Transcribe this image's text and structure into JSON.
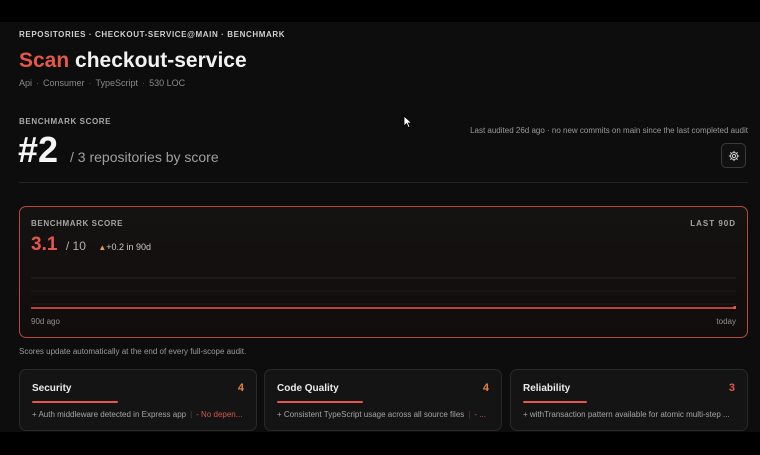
{
  "breadcrumb": "REPOSITORIES · CHECKOUT-SERVICE@MAIN · BENCHMARK",
  "header": {
    "title_accent": "Scan",
    "title_name": "checkout-service",
    "meta": [
      "Api",
      "Consumer",
      "TypeScript",
      "530 LOC"
    ]
  },
  "benchmark": {
    "label": "BENCHMARK SCORE",
    "rank": "#2",
    "rank_sub": "/ 3 repositories by score",
    "audit_note": "Last audited 26d ago · no new commits on main since the last completed audit"
  },
  "settings": {
    "icon": "gear-icon"
  },
  "score_card": {
    "label": "BENCHMARK SCORE",
    "range": "LAST 90D",
    "score": "3.1",
    "max": "/ 10",
    "delta": "+0.2 in 90d",
    "x_start": "90d ago",
    "x_end": "today"
  },
  "chart_data": {
    "type": "line",
    "x": [
      "90d ago",
      "today"
    ],
    "series": [
      {
        "values": [
          2.9,
          3.1
        ]
      }
    ],
    "ylim": [
      0,
      10
    ],
    "grid": true
  },
  "footnote": "Scores update automatically at the end of every full-scope audit.",
  "metrics": [
    {
      "name": "Security",
      "score": "4",
      "score_fraction": 0.4,
      "note": "+ Auth middleware detected in Express app",
      "note_neg": "- No depen..."
    },
    {
      "name": "Code Quality",
      "score": "4",
      "score_fraction": 0.4,
      "note": "+ Consistent TypeScript usage across all source files",
      "note_neg": "- ..."
    },
    {
      "name": "Reliability",
      "score": "3",
      "score_fraction": 0.3,
      "note": "+ withTransaction pattern available for atomic multi-step ...",
      "note_neg": ""
    }
  ],
  "colors": {
    "accent": "#e5574a",
    "amber": "#e8843a",
    "background": "#0d0d0d",
    "card_border": "#b7483e"
  }
}
